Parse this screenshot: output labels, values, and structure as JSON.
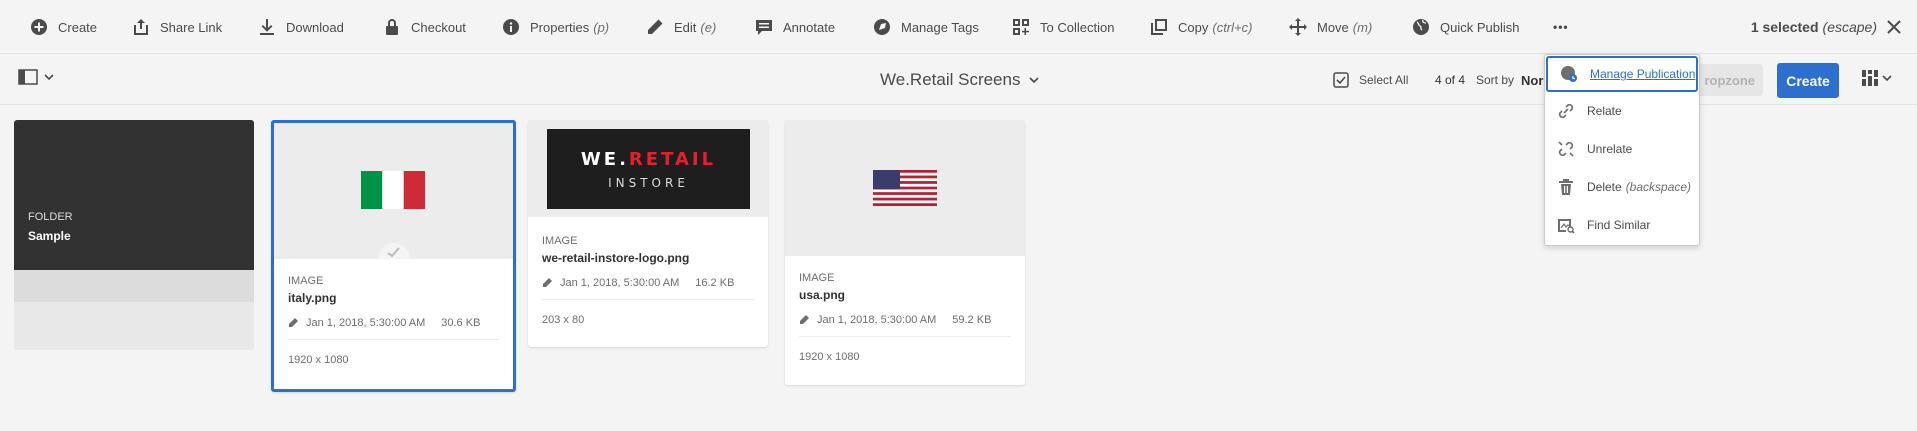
{
  "actionbar": {
    "items": [
      {
        "label": "Create",
        "icon": "add-circle-icon"
      },
      {
        "label": "Share Link",
        "icon": "share-icon"
      },
      {
        "label": "Download",
        "icon": "download-icon"
      },
      {
        "label": "Checkout",
        "icon": "lock-icon"
      },
      {
        "label": "Properties",
        "shortcut": "(p)",
        "icon": "info-icon"
      },
      {
        "label": "Edit",
        "shortcut": "(e)",
        "icon": "edit-icon"
      },
      {
        "label": "Annotate",
        "icon": "comment-icon"
      },
      {
        "label": "Manage Tags",
        "icon": "tag-icon"
      },
      {
        "label": "To Collection",
        "icon": "collection-add-icon"
      },
      {
        "label": "Copy",
        "shortcut": "(ctrl+c)",
        "icon": "copy-icon"
      },
      {
        "label": "Move",
        "shortcut": "(m)",
        "icon": "move-icon"
      },
      {
        "label": "Quick Publish",
        "icon": "globe-icon"
      }
    ],
    "more_label": "•••",
    "selected_text": "1 selected",
    "selected_shortcut": "(escape)"
  },
  "toolbar": {
    "title": "We.Retail Screens",
    "select_all": "Select All",
    "count": "4 of 4",
    "sort_by": "Sort by",
    "sort_value": "Nor",
    "dropzone": "ropzone",
    "create": "Create"
  },
  "cards": [
    {
      "type": "FOLDER",
      "name": "Sample"
    },
    {
      "type": "IMAGE",
      "name": "italy.png",
      "date": "Jan 1, 2018, 5:30:00 AM",
      "size": "30.6 KB",
      "dims": "1920 x 1080"
    },
    {
      "type": "IMAGE",
      "name": "we-retail-instore-logo.png",
      "date": "Jan 1, 2018, 5:30:00 AM",
      "size": "16.2 KB",
      "dims": "203 x 80",
      "logo_line1": "WE.",
      "logo_line1b": "RETAIL",
      "logo_line2": "INSTORE"
    },
    {
      "type": "IMAGE",
      "name": "usa.png",
      "date": "Jan 1, 2018, 5:30:00 AM",
      "size": "59.2 KB",
      "dims": "1920 x 1080"
    }
  ],
  "menu": {
    "items": [
      {
        "label": "Manage Publication",
        "icon": "publish-icon"
      },
      {
        "label": "Relate",
        "icon": "link-icon"
      },
      {
        "label": "Unrelate",
        "icon": "unlink-icon"
      },
      {
        "label": "Delete",
        "shortcut": "(backspace)",
        "icon": "trash-icon"
      },
      {
        "label": "Find Similar",
        "icon": "image-search-icon"
      }
    ]
  },
  "colors": {
    "accent": "#2d6fcf",
    "folder": "#323232",
    "retail_red": "#e5202a"
  }
}
